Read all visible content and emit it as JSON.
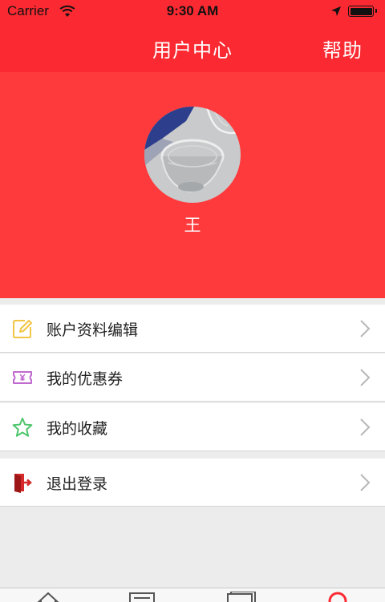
{
  "status_bar": {
    "carrier": "Carrier",
    "time": "9:30 AM"
  },
  "header": {
    "title": "用户中心",
    "help": "帮助"
  },
  "profile": {
    "name": "王"
  },
  "menu": {
    "items": [
      {
        "label": "账户资料编辑",
        "icon": "edit-icon",
        "color": "#f2c544"
      },
      {
        "label": "我的优惠券",
        "icon": "coupon-icon",
        "color": "#c06ad0"
      },
      {
        "label": "我的收藏",
        "icon": "star-icon",
        "color": "#4cc56a"
      },
      {
        "label": "退出登录",
        "icon": "logout-icon",
        "color": "#d62a2a"
      }
    ]
  },
  "tab_bar": {
    "icons": [
      "home-icon",
      "list-icon",
      "document-icon",
      "user-icon"
    ],
    "active_color": "#fb2a32"
  },
  "colors": {
    "accent": "#fb2a32",
    "profile_bg": "#fe3a3c",
    "page_bg": "#ececec"
  }
}
